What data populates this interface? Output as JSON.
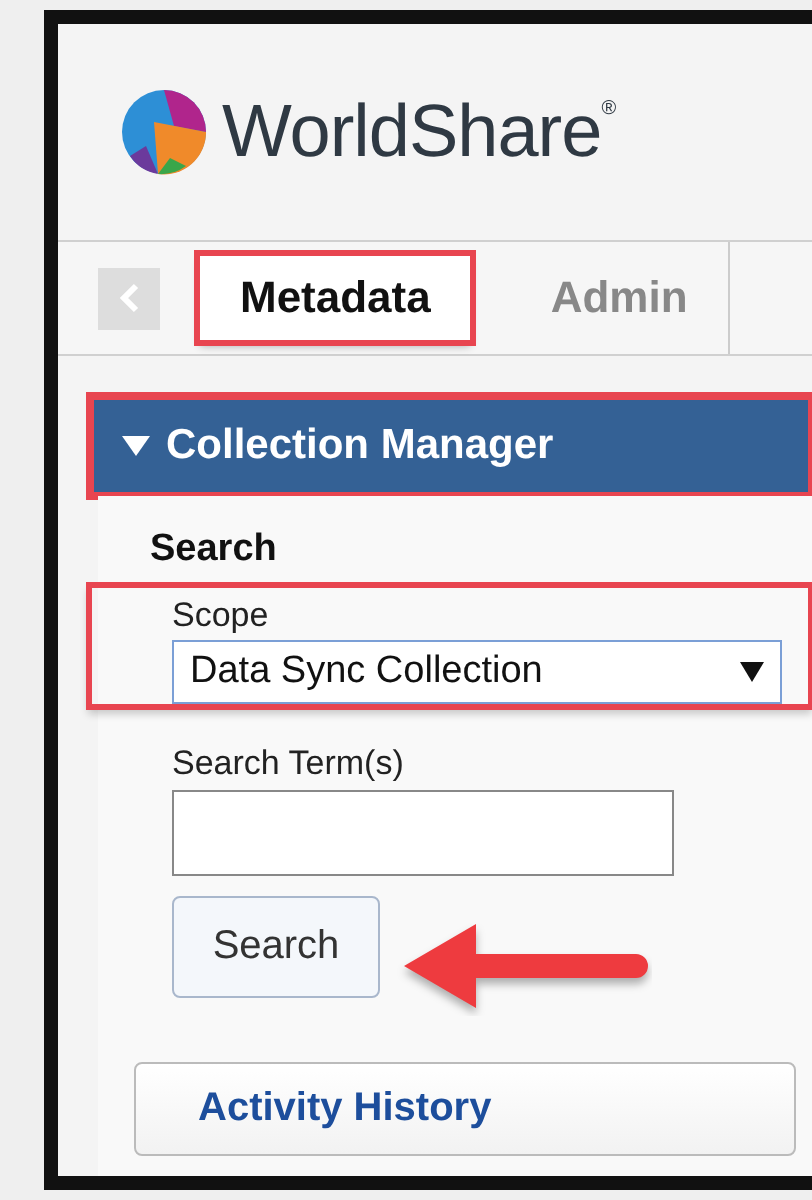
{
  "logo": {
    "text": "WorldShare$^{®}$"
  },
  "tabs": [
    {
      "label": "Metadata",
      "selected": true,
      "highlighted": true
    },
    {
      "label": "Admin",
      "selected": false,
      "highlighted": false
    }
  ],
  "section": {
    "title": "Collection Manager",
    "expanded": true,
    "highlighted": true
  },
  "search": {
    "heading": "Search",
    "scope": {
      "label": "Scope",
      "value": "Data Sync Collection",
      "highlighted": true
    },
    "terms": {
      "label": "Search Term(s)"
    },
    "button": "Search"
  },
  "activity_button": "Activity History"
}
